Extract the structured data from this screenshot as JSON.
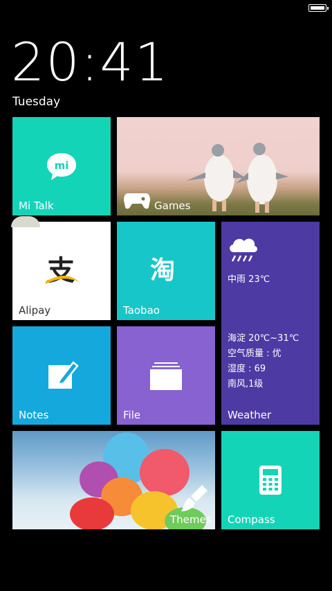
{
  "status_bar": {
    "battery": "battery-full-icon"
  },
  "lockscreen": {
    "time": "20:41",
    "day": "Tuesday"
  },
  "tiles": {
    "mitalk": {
      "label": "Mi Talk",
      "icon": "mi-talk-bubble-icon",
      "badge": "mi",
      "color": "#14d4b8"
    },
    "games": {
      "label": "Games",
      "icon": "gamepad-icon"
    },
    "alipay": {
      "label": "Alipay",
      "icon": "alipay-logo-icon",
      "logo_char": "支"
    },
    "taobao": {
      "label": "Taobao",
      "icon": "taobao-logo-icon",
      "logo_char": "淘",
      "color": "#17c6c9"
    },
    "weather": {
      "label": "Weather",
      "icon": "cloud-rain-icon",
      "condition": "中雨 23℃",
      "location_range": "海淀 20℃~31℃",
      "air_quality": "空气质量 : 优",
      "humidity": "湿度 : 69",
      "wind": "南风,1级",
      "color": "#4e3aa3"
    },
    "notes": {
      "label": "Notes",
      "icon": "pencil-note-icon",
      "color": "#14a8dd"
    },
    "file": {
      "label": "File",
      "icon": "folder-icon",
      "color": "#8762d0"
    },
    "themes": {
      "label": "Themes",
      "icon": "paintbrush-icon"
    },
    "compass": {
      "label": "Compass",
      "icon": "calculator-icon",
      "color": "#14d4b8"
    }
  }
}
